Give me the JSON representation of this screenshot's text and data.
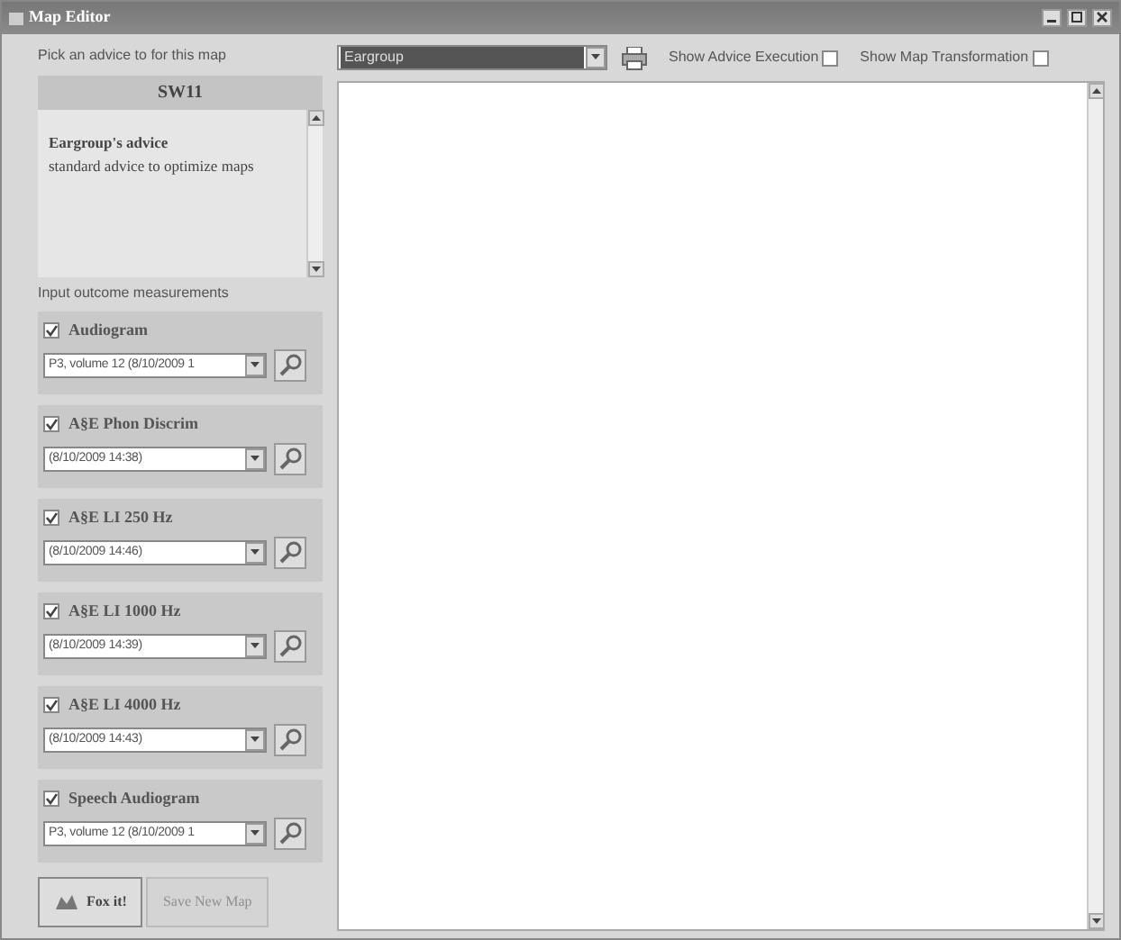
{
  "window": {
    "title": "Map Editor"
  },
  "advice_panel": {
    "label": "Pick an advice to for this map",
    "header": "SW11",
    "title": "Eargroup's advice",
    "description": "standard advice to optimize maps"
  },
  "measurements_label": "Input outcome measurements",
  "measurements": [
    {
      "name": "Audiogram",
      "checked": true,
      "value": "P3, volume 12 (8/10/2009 1"
    },
    {
      "name": "A§E Phon Discrim",
      "checked": true,
      "value": "(8/10/2009 14:38)"
    },
    {
      "name": "A§E LI 250 Hz",
      "checked": true,
      "value": "(8/10/2009 14:46)"
    },
    {
      "name": "A§E LI 1000 Hz",
      "checked": true,
      "value": "(8/10/2009 14:39)"
    },
    {
      "name": "A§E LI 4000 Hz",
      "checked": true,
      "value": "(8/10/2009 14:43)"
    },
    {
      "name": "Speech Audiogram",
      "checked": true,
      "value": "P3, volume 12 (8/10/2009 1"
    }
  ],
  "buttons": [
    {
      "label": "Fox it!",
      "disabled": false
    },
    {
      "label": "Save New Map",
      "disabled": true
    }
  ],
  "toolbar": {
    "group": "Eargroup",
    "options": [
      {
        "label": "Show Advice Execution",
        "checked": false
      },
      {
        "label": "Show Map Transformation",
        "checked": false
      }
    ]
  }
}
